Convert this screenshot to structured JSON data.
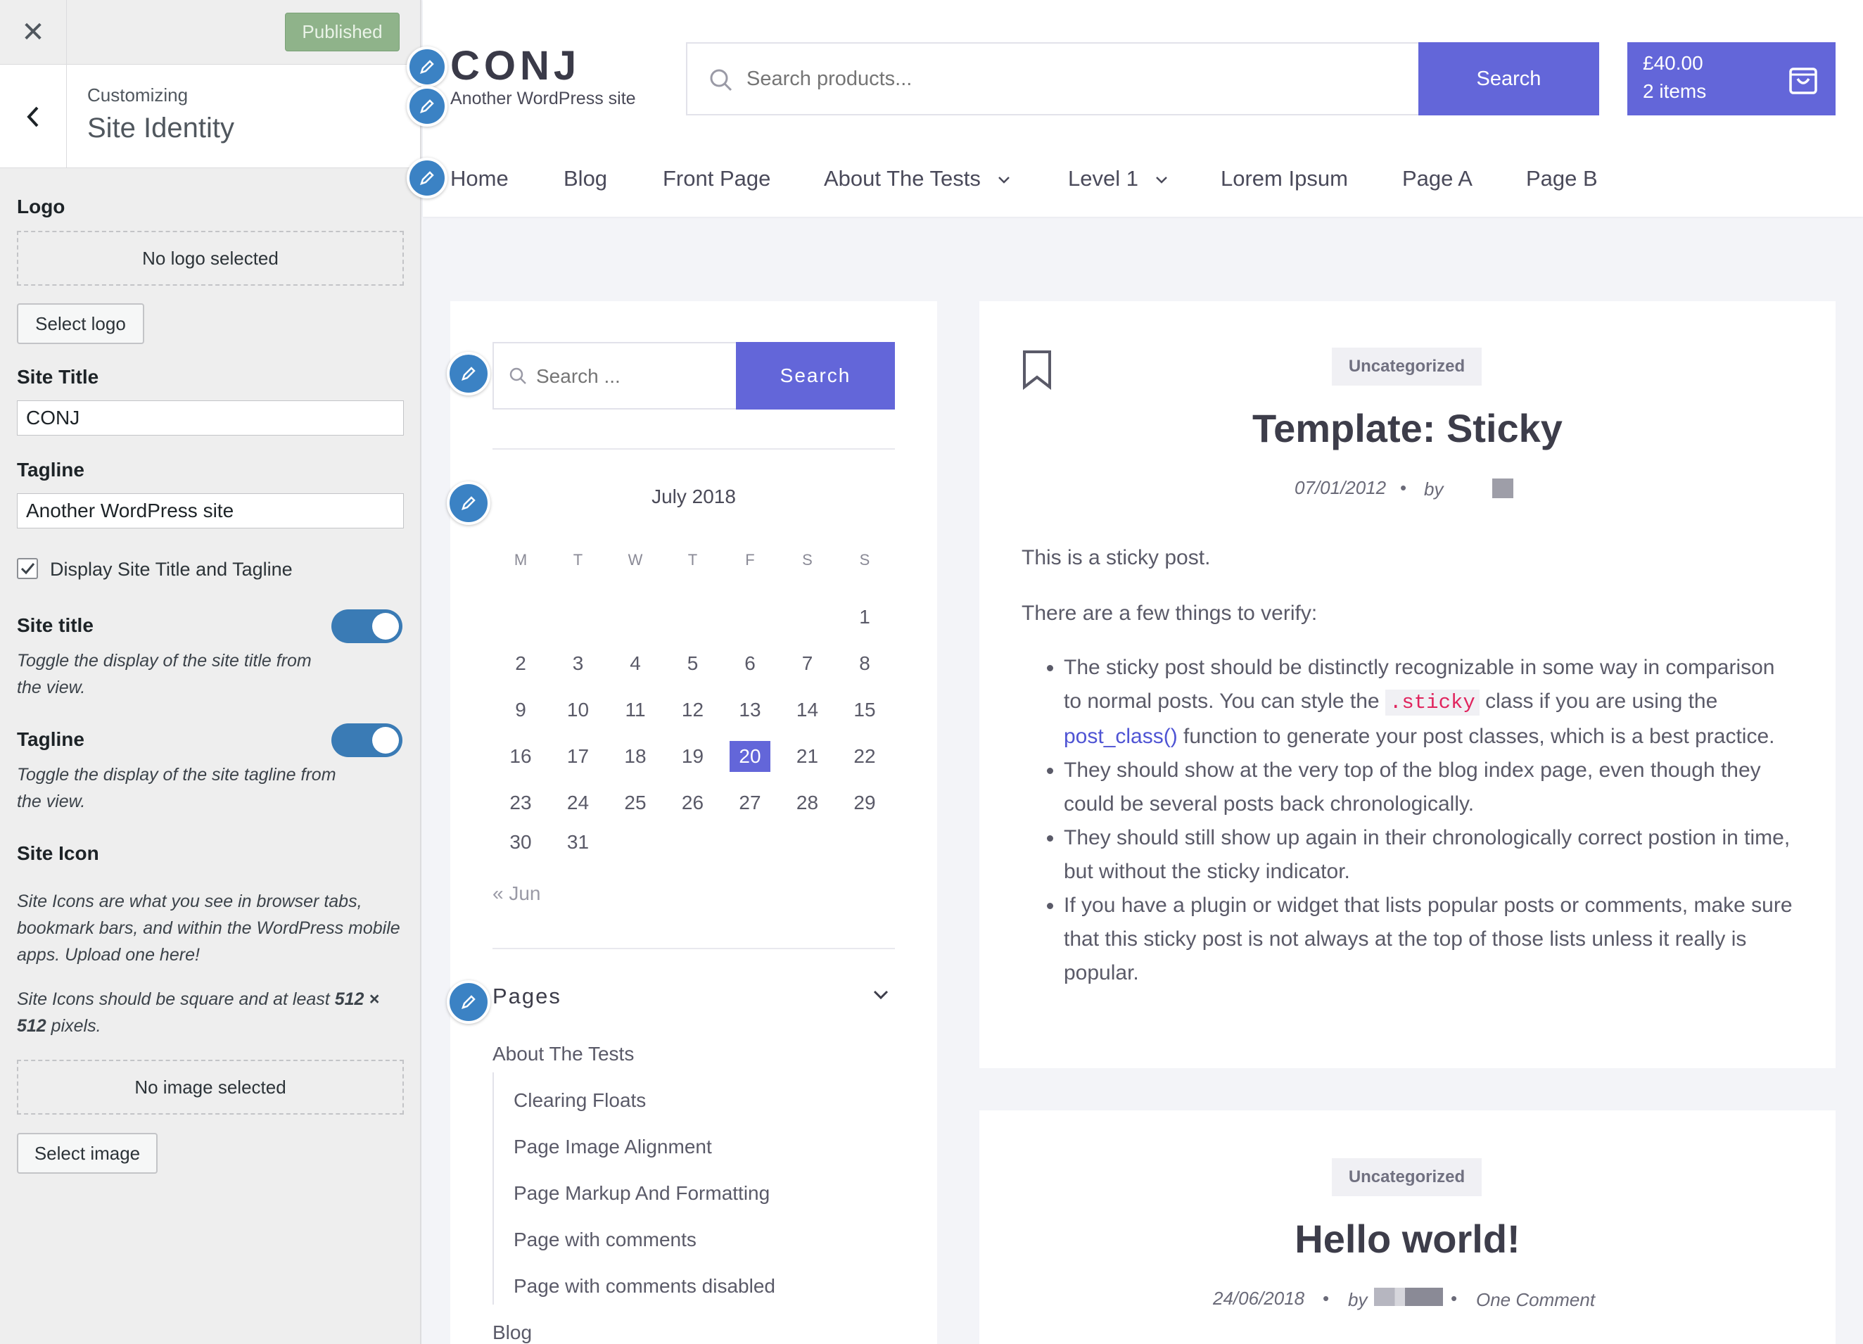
{
  "panel": {
    "publish_label": "Published",
    "customizing_label": "Customizing",
    "section_title": "Site Identity",
    "logo_label": "Logo",
    "no_logo": "No logo selected",
    "select_logo": "Select logo",
    "site_title_label": "Site Title",
    "site_title_value": "CONJ",
    "tagline_label": "Tagline",
    "tagline_value": "Another WordPress site",
    "display_checkbox_label": "Display Site Title and Tagline",
    "site_title_toggle_label": "Site title",
    "site_title_toggle_desc": "Toggle the display of the site title from the view.",
    "tagline_toggle_label": "Tagline",
    "tagline_toggle_desc": "Toggle the display of the site tagline from the view.",
    "site_icon_label": "Site Icon",
    "site_icon_desc1": "Site Icons are what you see in browser tabs, bookmark bars, and within the WordPress mobile apps. Upload one here!",
    "site_icon_desc2_pre": "Site Icons should be square and at least ",
    "site_icon_desc2_bold": "512 × 512",
    "site_icon_desc2_post": " pixels.",
    "no_image": "No image selected",
    "select_image": "Select image"
  },
  "header": {
    "site_title": "CONJ",
    "tagline": "Another WordPress site",
    "search_placeholder": "Search products...",
    "search_button": "Search",
    "cart_total": "£40.00",
    "cart_items": "2 items"
  },
  "nav": [
    "Home",
    "Blog",
    "Front Page",
    "About The Tests",
    "Level 1",
    "Lorem Ipsum",
    "Page A",
    "Page B"
  ],
  "sidebar": {
    "search_placeholder": "Search ...",
    "search_button": "Search",
    "calendar_month": "July 2018",
    "weekdays": [
      "M",
      "T",
      "W",
      "T",
      "F",
      "S",
      "S"
    ],
    "days": [
      "1",
      "2",
      "3",
      "4",
      "5",
      "6",
      "7",
      "8",
      "9",
      "10",
      "11",
      "12",
      "13",
      "14",
      "15",
      "16",
      "17",
      "18",
      "19",
      "20",
      "21",
      "22",
      "23",
      "24",
      "25",
      "26",
      "27",
      "28",
      "29",
      "30",
      "31"
    ],
    "today": "20",
    "prev_month": "« Jun",
    "pages_title": "Pages",
    "pages": [
      "About The Tests",
      "Clearing Floats",
      "Page Image Alignment",
      "Page Markup And Formatting",
      "Page with comments",
      "Page with comments disabled",
      "Blog"
    ]
  },
  "posts": [
    {
      "category": "Uncategorized",
      "title": "Template: Sticky",
      "date": "07/01/2012",
      "by": "by",
      "intro1": "This is a sticky post.",
      "intro2": "There are a few things to verify:",
      "bullet1_a": "The sticky post should be distinctly recognizable in some way in comparison to normal posts. You can style the ",
      "bullet1_code": ".sticky",
      "bullet1_b": " class if you are using the ",
      "bullet1_link": "post_class()",
      "bullet1_c": " function to generate your post classes, which is a best practice.",
      "bullet2": "They should show at the very top of the blog index page, even though they could be several posts back chronologically.",
      "bullet3": "They should still show up again in their chronologically correct postion in time, but without the sticky indicator.",
      "bullet4": "If you have a plugin or widget that lists popular posts or comments, make sure that this sticky post is not always at the top of those lists unless it really is popular."
    },
    {
      "category": "Uncategorized",
      "title": "Hello world!",
      "date": "24/06/2018",
      "by": "by",
      "comments": "One Comment"
    }
  ],
  "colors": {
    "accent": "#6366d9",
    "toggle_on": "#3a7bb5",
    "edit_dot": "#3b82c4",
    "published": "#8fb38a"
  }
}
